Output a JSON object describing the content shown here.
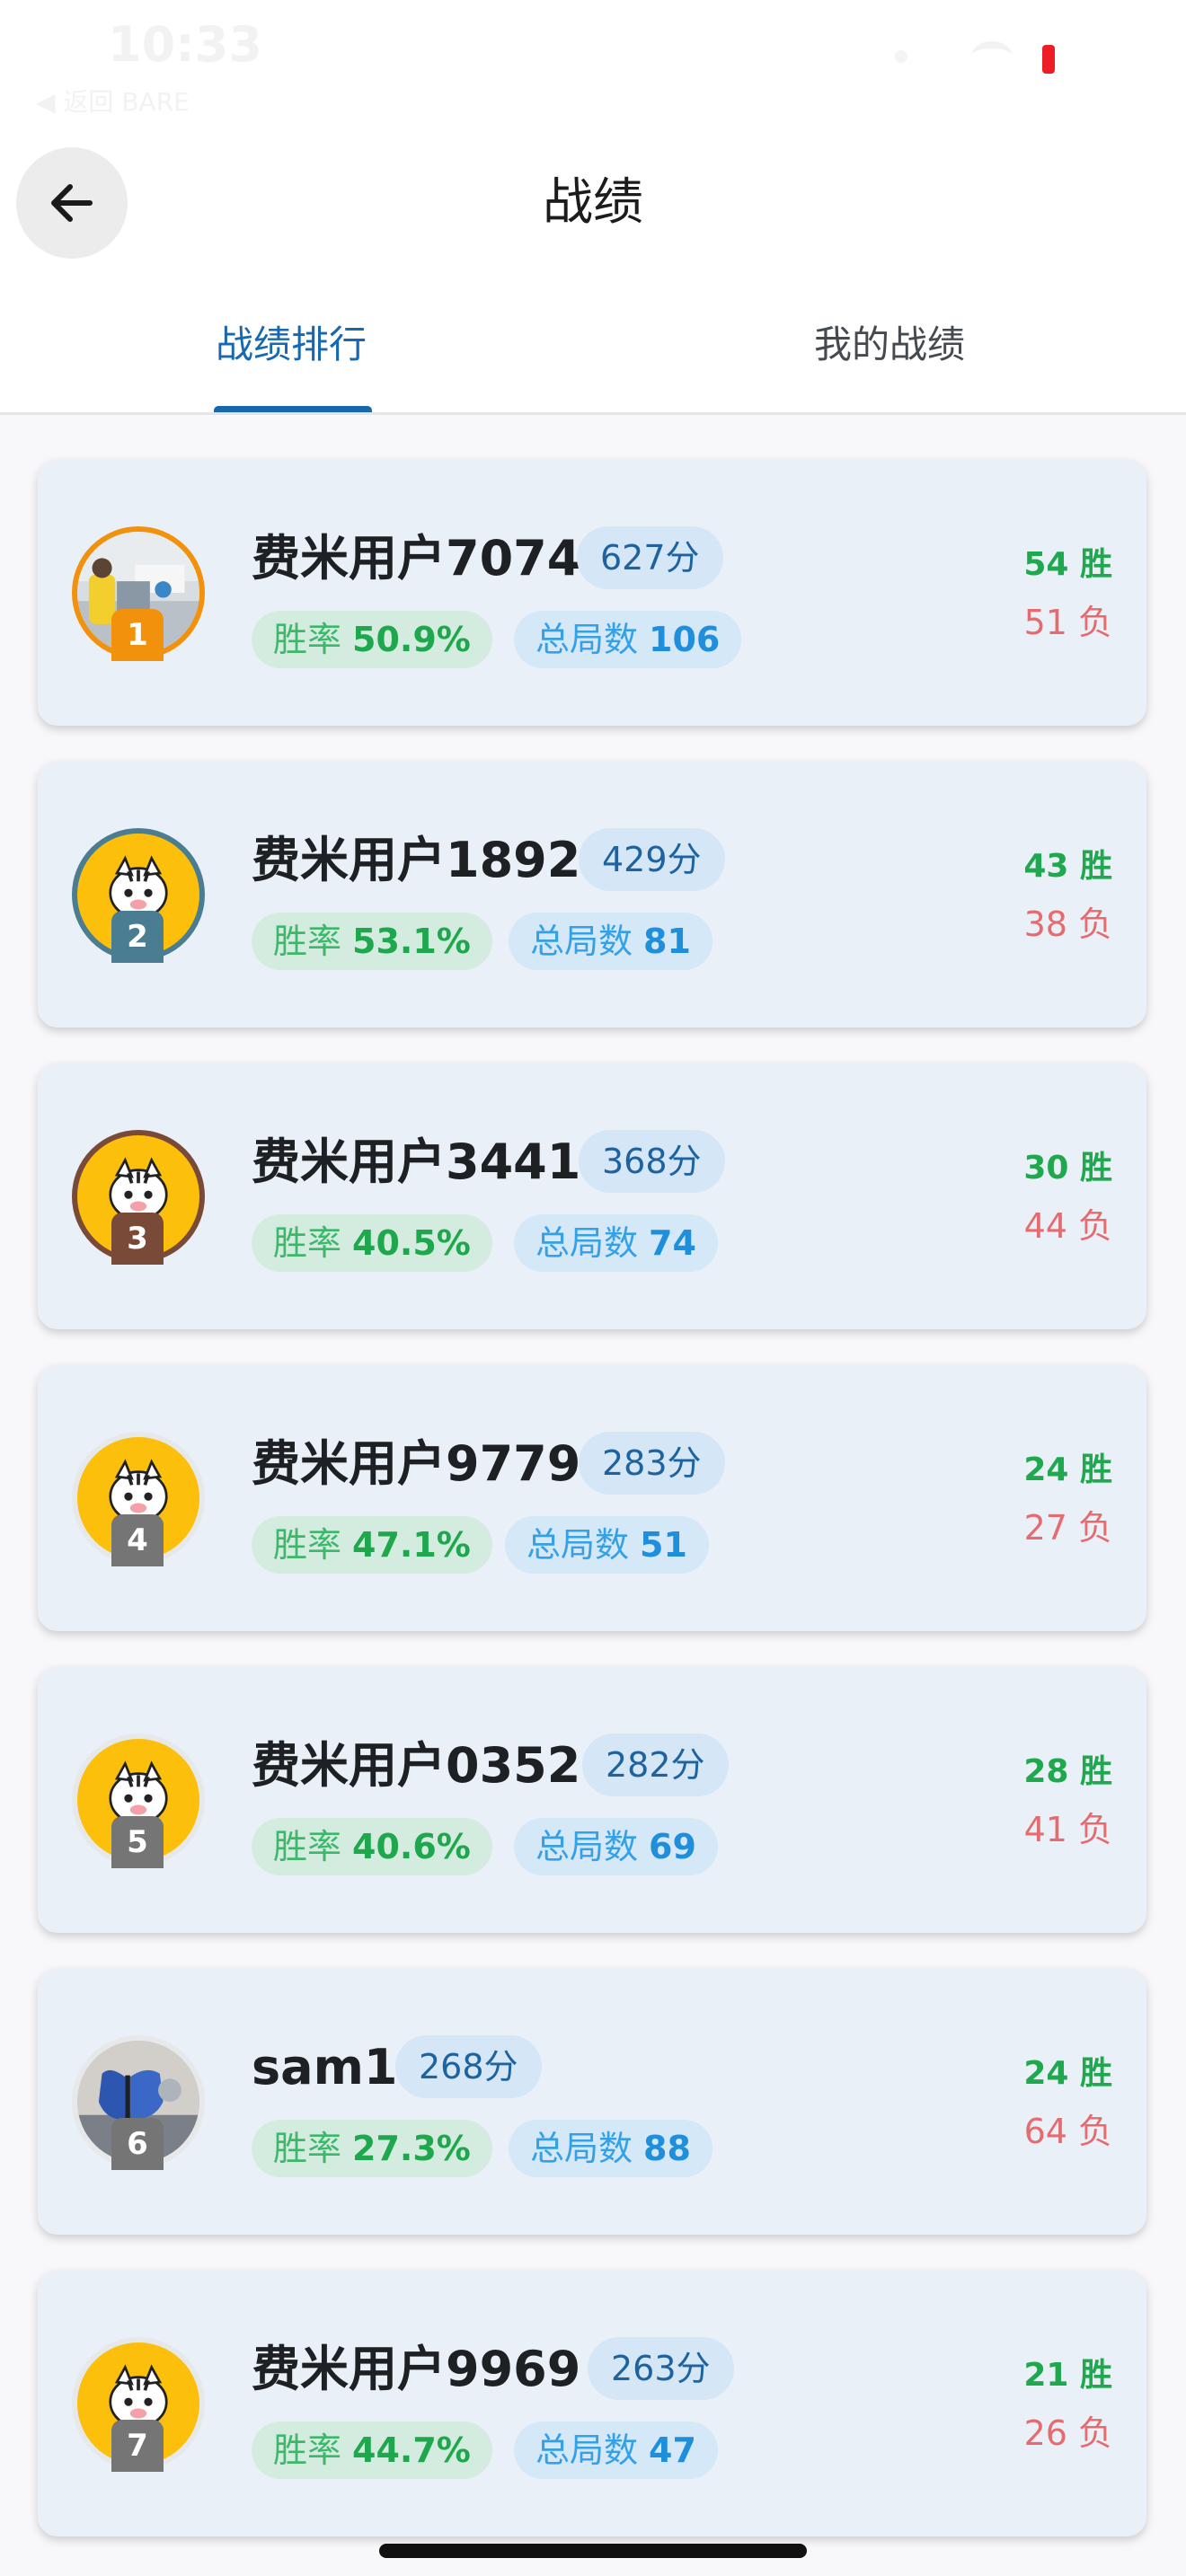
{
  "status_bar": {
    "time": "10:33",
    "back_label": "◀ 返回 BARE"
  },
  "header": {
    "title": "战绩",
    "back_icon": "arrow-left-icon"
  },
  "tabs": [
    {
      "label": "战绩排行",
      "selected": true
    },
    {
      "label": "我的战绩",
      "selected": false
    }
  ],
  "leaderboard": [
    {
      "rank": "1",
      "name": "费米用户7074",
      "score": "627分",
      "winrate_label": "胜率",
      "winrate": "50.9%",
      "games_label": "总局数",
      "games": "106",
      "wins": "54 胜",
      "losses": "51 负",
      "avatar": "photo-avatar"
    },
    {
      "rank": "2",
      "name": "费米用户1892",
      "score": "429分",
      "winrate_label": "胜率",
      "winrate": "53.1%",
      "games_label": "总局数",
      "games": "81",
      "wins": "43 胜",
      "losses": "38 负",
      "avatar": "zebra-mascot-avatar"
    },
    {
      "rank": "3",
      "name": "费米用户3441",
      "score": "368分",
      "winrate_label": "胜率",
      "winrate": "40.5%",
      "games_label": "总局数",
      "games": "74",
      "wins": "30 胜",
      "losses": "44 负",
      "avatar": "zebra-mascot-avatar"
    },
    {
      "rank": "4",
      "name": "费米用户9779",
      "score": "283分",
      "winrate_label": "胜率",
      "winrate": "47.1%",
      "games_label": "总局数",
      "games": "51",
      "wins": "24 胜",
      "losses": "27 负",
      "avatar": "zebra-mascot-avatar"
    },
    {
      "rank": "5",
      "name": "费米用户0352",
      "score": "282分",
      "winrate_label": "胜率",
      "winrate": "40.6%",
      "games_label": "总局数",
      "games": "69",
      "wins": "28 胜",
      "losses": "41 负",
      "avatar": "zebra-mascot-avatar"
    },
    {
      "rank": "6",
      "name": "sam1",
      "score": "268分",
      "winrate_label": "胜率",
      "winrate": "27.3%",
      "games_label": "总局数",
      "games": "88",
      "wins": "24 胜",
      "losses": "64 负",
      "avatar": "butterfly-photo-avatar"
    },
    {
      "rank": "7",
      "name": "费米用户9969",
      "score": "263分",
      "winrate_label": "胜率",
      "winrate": "44.7%",
      "games_label": "总局数",
      "games": "47",
      "wins": "21 胜",
      "losses": "26 负",
      "avatar": "zebra-mascot-avatar"
    }
  ],
  "colors": {
    "accent": "#1767ad",
    "card_background": "#eaf0f7",
    "win_green": "#1fa84e",
    "loss_red": "#e56b6f",
    "rank1_badge": "#f2910c",
    "rank2_badge": "#4a7d92",
    "rank3_badge": "#7a4a38",
    "rank_badge_default": "#757575"
  }
}
